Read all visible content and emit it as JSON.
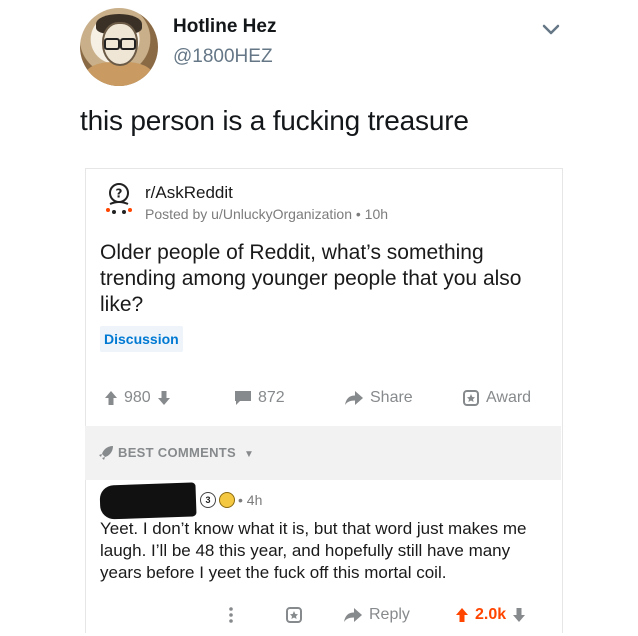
{
  "tweet": {
    "display_name": "Hotline Hez",
    "handle": "@1800HEZ",
    "text": "this person is a fucking treasure"
  },
  "post": {
    "subreddit": "r/AskReddit",
    "posted_by": "Posted by u/UnluckyOrganization • 10h",
    "title": "Older people of Reddit, what’s something trending among younger people that you also like?",
    "flair": "Discussion",
    "upvotes": "980",
    "comments": "872",
    "share_label": "Share",
    "award_label": "Award"
  },
  "comments_section": {
    "sort_label": "BEST COMMENTS",
    "comment": {
      "karma_badge": "3",
      "age": "• 4h",
      "text": "Yeet. I don’t know what it is, but that word just makes me laugh. I’ll be 48 this year, and hopefully still have many years before I yeet the fuck off this mortal coil.",
      "reply_label": "Reply",
      "score": "2.0k"
    }
  },
  "colors": {
    "accent_blue": "#0079d3",
    "upvote_orange": "#ff4500",
    "muted_gray": "#878a8c"
  },
  "icons": [
    "chevron-down-icon",
    "subreddit-icon",
    "upvote-icon",
    "downvote-icon",
    "comment-icon",
    "share-icon",
    "award-icon",
    "rocket-icon",
    "more-icon",
    "reply-icon"
  ]
}
